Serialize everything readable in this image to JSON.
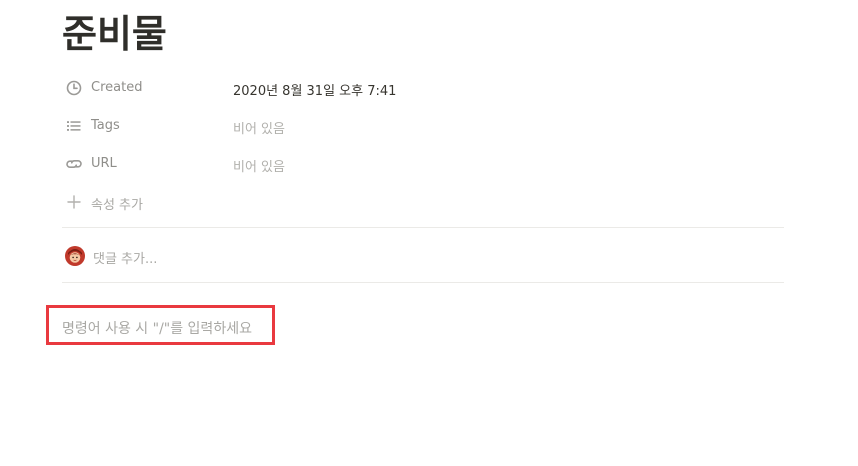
{
  "page": {
    "title": "준비물"
  },
  "properties": [
    {
      "icon": "clock-icon",
      "name": "Created",
      "value": "2020년 8월 31일 오후 7:41",
      "empty": false
    },
    {
      "icon": "list-icon",
      "name": "Tags",
      "value": "비어 있음",
      "empty": true
    },
    {
      "icon": "link-icon",
      "name": "URL",
      "value": "비어 있음",
      "empty": true
    }
  ],
  "add_property": {
    "icon": "plus-icon",
    "label": "속성 추가"
  },
  "comment": {
    "placeholder": "댓글 추가..."
  },
  "editor": {
    "placeholder": "명령어 사용 시 \"/\"를 입력하세요"
  },
  "colors": {
    "highlight": "#e9393f",
    "text": "#37352f",
    "muted": "#8f8e8a",
    "placeholder": "#a9a8a4"
  }
}
